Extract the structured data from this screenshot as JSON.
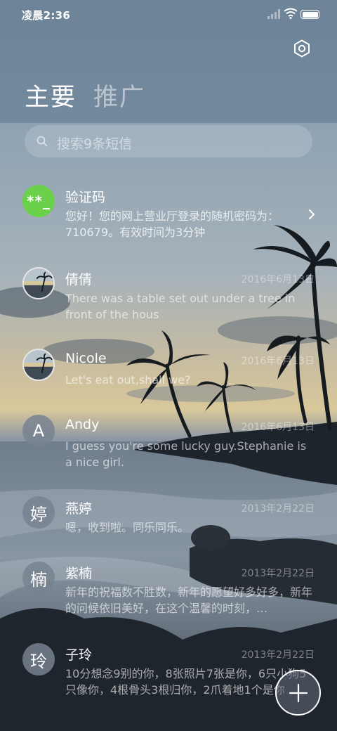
{
  "status_bar": {
    "time": "凌晨2:36",
    "icons": [
      "signal-icon",
      "wifi-icon",
      "battery-icon"
    ]
  },
  "header": {
    "tabs": [
      {
        "label": "主要",
        "active": true
      },
      {
        "label": "推广",
        "active": false
      }
    ],
    "settings_icon": "gear-icon"
  },
  "search": {
    "placeholder": "搜索9条短信"
  },
  "messages": [
    {
      "sender": "验证码",
      "avatar_text": "**_",
      "avatar_type": "green",
      "preview": "您好！您的网上营业厅登录的随机密码为：710679。有效时间为3分钟",
      "date": "",
      "has_chevron": true
    },
    {
      "sender": "倩倩",
      "avatar_type": "photo",
      "preview": "There was a table set out under a tree in front of the hous",
      "date": "2016年6月13日"
    },
    {
      "sender": "Nicole",
      "avatar_type": "photo",
      "preview": "Let's eat out,shall we?",
      "date": "2016年6月13日"
    },
    {
      "sender": "Andy",
      "avatar_text": "A",
      "avatar_type": "letter",
      "preview": "I guess you're some lucky guy.Stephanie is a nice girl.",
      "date": "2016年6月13日"
    },
    {
      "sender": "燕婷",
      "avatar_text": "婷",
      "avatar_type": "letter",
      "preview": "嗯，收到啦。同乐同乐。",
      "date": "2013年2月22日"
    },
    {
      "sender": "紫楠",
      "avatar_text": "楠",
      "avatar_type": "letter",
      "preview": "新年的祝福数不胜数，新年的愿望好多好多，新年的问候依旧美好，在这个温馨的时刻，…",
      "date": "2013年2月22日"
    },
    {
      "sender": "子玲",
      "avatar_text": "玲",
      "avatar_type": "letter",
      "preview": "10分想念9别的你，8张照片7张是你，6只小狗5只像你，4根骨头3根归你，2爪着地1个是你",
      "date": "2013年2月22日"
    }
  ],
  "fab": {
    "icon": "plus-icon"
  },
  "colors": {
    "accent_green": "#6bd04a",
    "background": "#5e7280"
  }
}
